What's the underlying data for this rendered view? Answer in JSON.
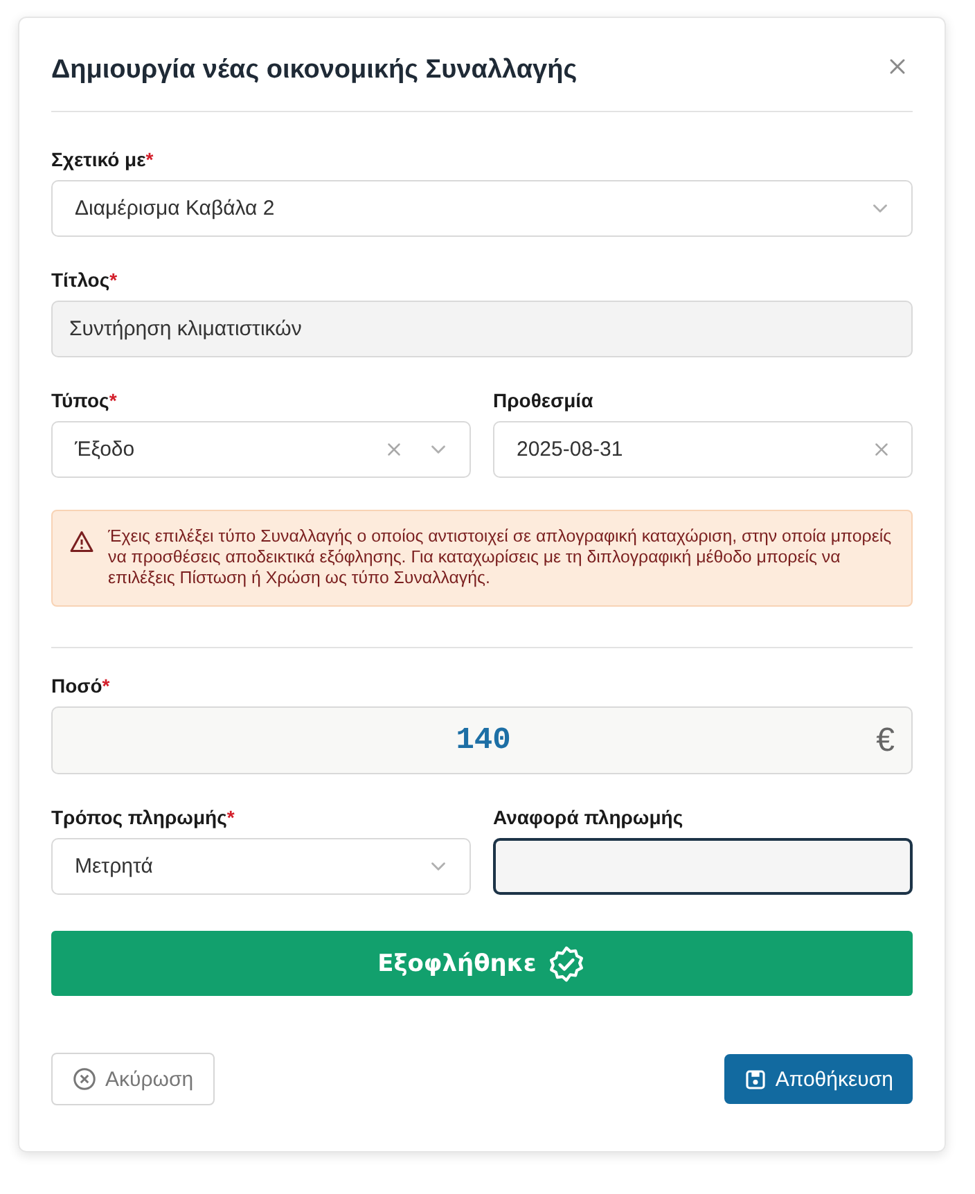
{
  "dialog": {
    "title": "Δημιουργία νέας οικονομικής Συναλλαγής"
  },
  "sections": [
    {
      "kind": "fields",
      "fields": [
        {
          "label": "Σχετικό με",
          "required_mark": "*",
          "kind": "select",
          "value": "Διαμέρισμα Καβάλα 2",
          "clearable": false,
          "disabled": false,
          "focused": false
        }
      ]
    },
    {
      "kind": "fields",
      "fields": [
        {
          "label": "Τίτλος",
          "required_mark": "*",
          "kind": "text",
          "value": "Συντήρηση κλιματιστικών",
          "clearable": false,
          "disabled": true,
          "focused": false
        }
      ]
    },
    {
      "kind": "fields",
      "fields": [
        {
          "label": "Τύπος",
          "required_mark": "*",
          "kind": "select",
          "value": "Έξοδο",
          "clearable": true,
          "disabled": false,
          "focused": false
        },
        {
          "label": "Προθεσμία",
          "kind": "date",
          "value": "2025-08-31",
          "clearable": true,
          "disabled": false,
          "focused": false
        }
      ]
    },
    {
      "kind": "alert",
      "text": "Έχεις επιλέξει τύπο Συναλλαγής ο οποίος αντιστοιχεί σε απλογραφική καταχώριση, στην οποία μπορείς να προσθέσεις αποδεικτικά εξόφλησης. Για καταχωρίσεις με τη διπλογραφική μέθοδο μπορείς να επιλέξεις Πίστωση ή Χρώση ως τύπο Συναλλαγής."
    },
    {
      "kind": "divider"
    },
    {
      "kind": "fields",
      "fields": [
        {
          "label": "Ποσό",
          "required_mark": "*",
          "kind": "amount",
          "value": "140",
          "currency": "€",
          "clearable": false,
          "disabled": false,
          "focused": false
        }
      ]
    },
    {
      "kind": "fields",
      "fields": [
        {
          "label": "Τρόπος πληρωμής",
          "required_mark": "*",
          "kind": "select",
          "value": "Μετρητά",
          "clearable": false,
          "disabled": false,
          "focused": false
        },
        {
          "label": "Αναφορά πληρωμής",
          "kind": "text",
          "clearable": false,
          "disabled": false,
          "focused": true
        }
      ]
    },
    {
      "kind": "status",
      "label": "Εξοφλήθηκε",
      "paid": true
    }
  ],
  "footer": {
    "cancel": "Ακύρωση",
    "save": "Αποθήκευση"
  }
}
